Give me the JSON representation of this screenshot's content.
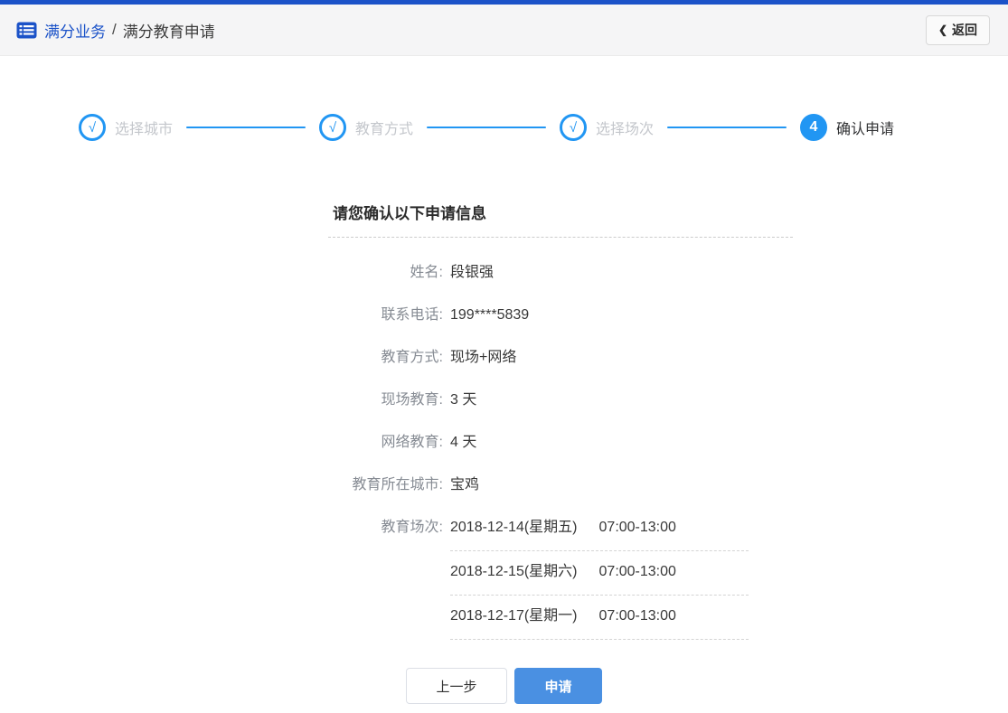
{
  "header": {
    "breadcrumb": {
      "root": "满分业务",
      "separator": "/",
      "current": "满分教育申请"
    },
    "back": {
      "chevron": "❮",
      "label": "返回"
    }
  },
  "stepper": {
    "steps": [
      {
        "symbol": "√",
        "label": "选择城市",
        "status": "done"
      },
      {
        "symbol": "√",
        "label": "教育方式",
        "status": "done"
      },
      {
        "symbol": "√",
        "label": "选择场次",
        "status": "done"
      },
      {
        "symbol": "4",
        "label": "确认申请",
        "status": "active"
      }
    ]
  },
  "form": {
    "title": "请您确认以下申请信息",
    "fields": [
      {
        "label": "姓名:",
        "value": "段银强"
      },
      {
        "label": "联系电话:",
        "value": "199****5839"
      },
      {
        "label": "教育方式:",
        "value": "现场+网络"
      },
      {
        "label": "现场教育:",
        "value": "3 天"
      },
      {
        "label": "网络教育:",
        "value": "4 天"
      },
      {
        "label": "教育所在城市:",
        "value": "宝鸡"
      }
    ],
    "sessions_label": "教育场次:",
    "sessions": [
      {
        "date": "2018-12-14(星期五)",
        "time": "07:00-13:00"
      },
      {
        "date": "2018-12-15(星期六)",
        "time": "07:00-13:00"
      },
      {
        "date": "2018-12-17(星期一)",
        "time": "07:00-13:00"
      }
    ]
  },
  "actions": {
    "prev": "上一步",
    "apply": "申请"
  },
  "colors": {
    "brand_blue": "#1b52c8",
    "stepper_blue": "#2196f3",
    "apply_button_blue": "#4a90e2",
    "header_background": "#f5f5f6",
    "inactive_step_label": "#c4c7cc",
    "field_label_gray": "#878c94"
  }
}
